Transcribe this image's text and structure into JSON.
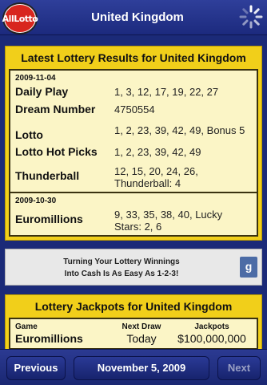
{
  "header": {
    "logo_text": "AllLotto",
    "title": "United Kingdom",
    "spinner_icon": "spinner-icon"
  },
  "results": {
    "heading": "Latest Lottery Results for United Kingdom",
    "groups": [
      {
        "date": "2009-11-04",
        "rows": [
          {
            "game": "Daily Play",
            "numbers": "1, 3, 12, 17, 19, 22, 27"
          },
          {
            "game": "Dream Number",
            "numbers": "4750554"
          },
          {
            "game": "Lotto",
            "numbers": "1, 2, 23, 39, 42, 49, Bonus 5"
          },
          {
            "game": "Lotto Hot Picks",
            "numbers": "1, 2, 23, 39, 42, 49"
          },
          {
            "game": "Thunderball",
            "numbers": "12, 15, 20, 24, 26, Thunderball: 4"
          }
        ]
      },
      {
        "date": "2009-10-30",
        "rows": [
          {
            "game": "Euromillions",
            "numbers": "9, 33, 35, 38, 40, Lucky Stars: 2, 6"
          }
        ]
      }
    ]
  },
  "ad": {
    "line1": "Turning Your Lottery Winnings",
    "line2": "Into Cash Is As Easy As 1-2-3!",
    "button": "g"
  },
  "jackpots": {
    "heading": "Lottery Jackpots for United Kingdom",
    "columns": [
      "Game",
      "Next Draw",
      "Jackpots"
    ],
    "rows": [
      {
        "game": "Euromillions",
        "next_draw": "Today",
        "jackpot": "$100,000,000"
      }
    ]
  },
  "footer": {
    "previous": "Previous",
    "date": "November 5, 2009",
    "next": "Next"
  },
  "colors": {
    "bar": "#1b2a78",
    "panel": "#f1cf1a",
    "inner": "#fbf5c6",
    "logo_red": "#d8261e"
  }
}
